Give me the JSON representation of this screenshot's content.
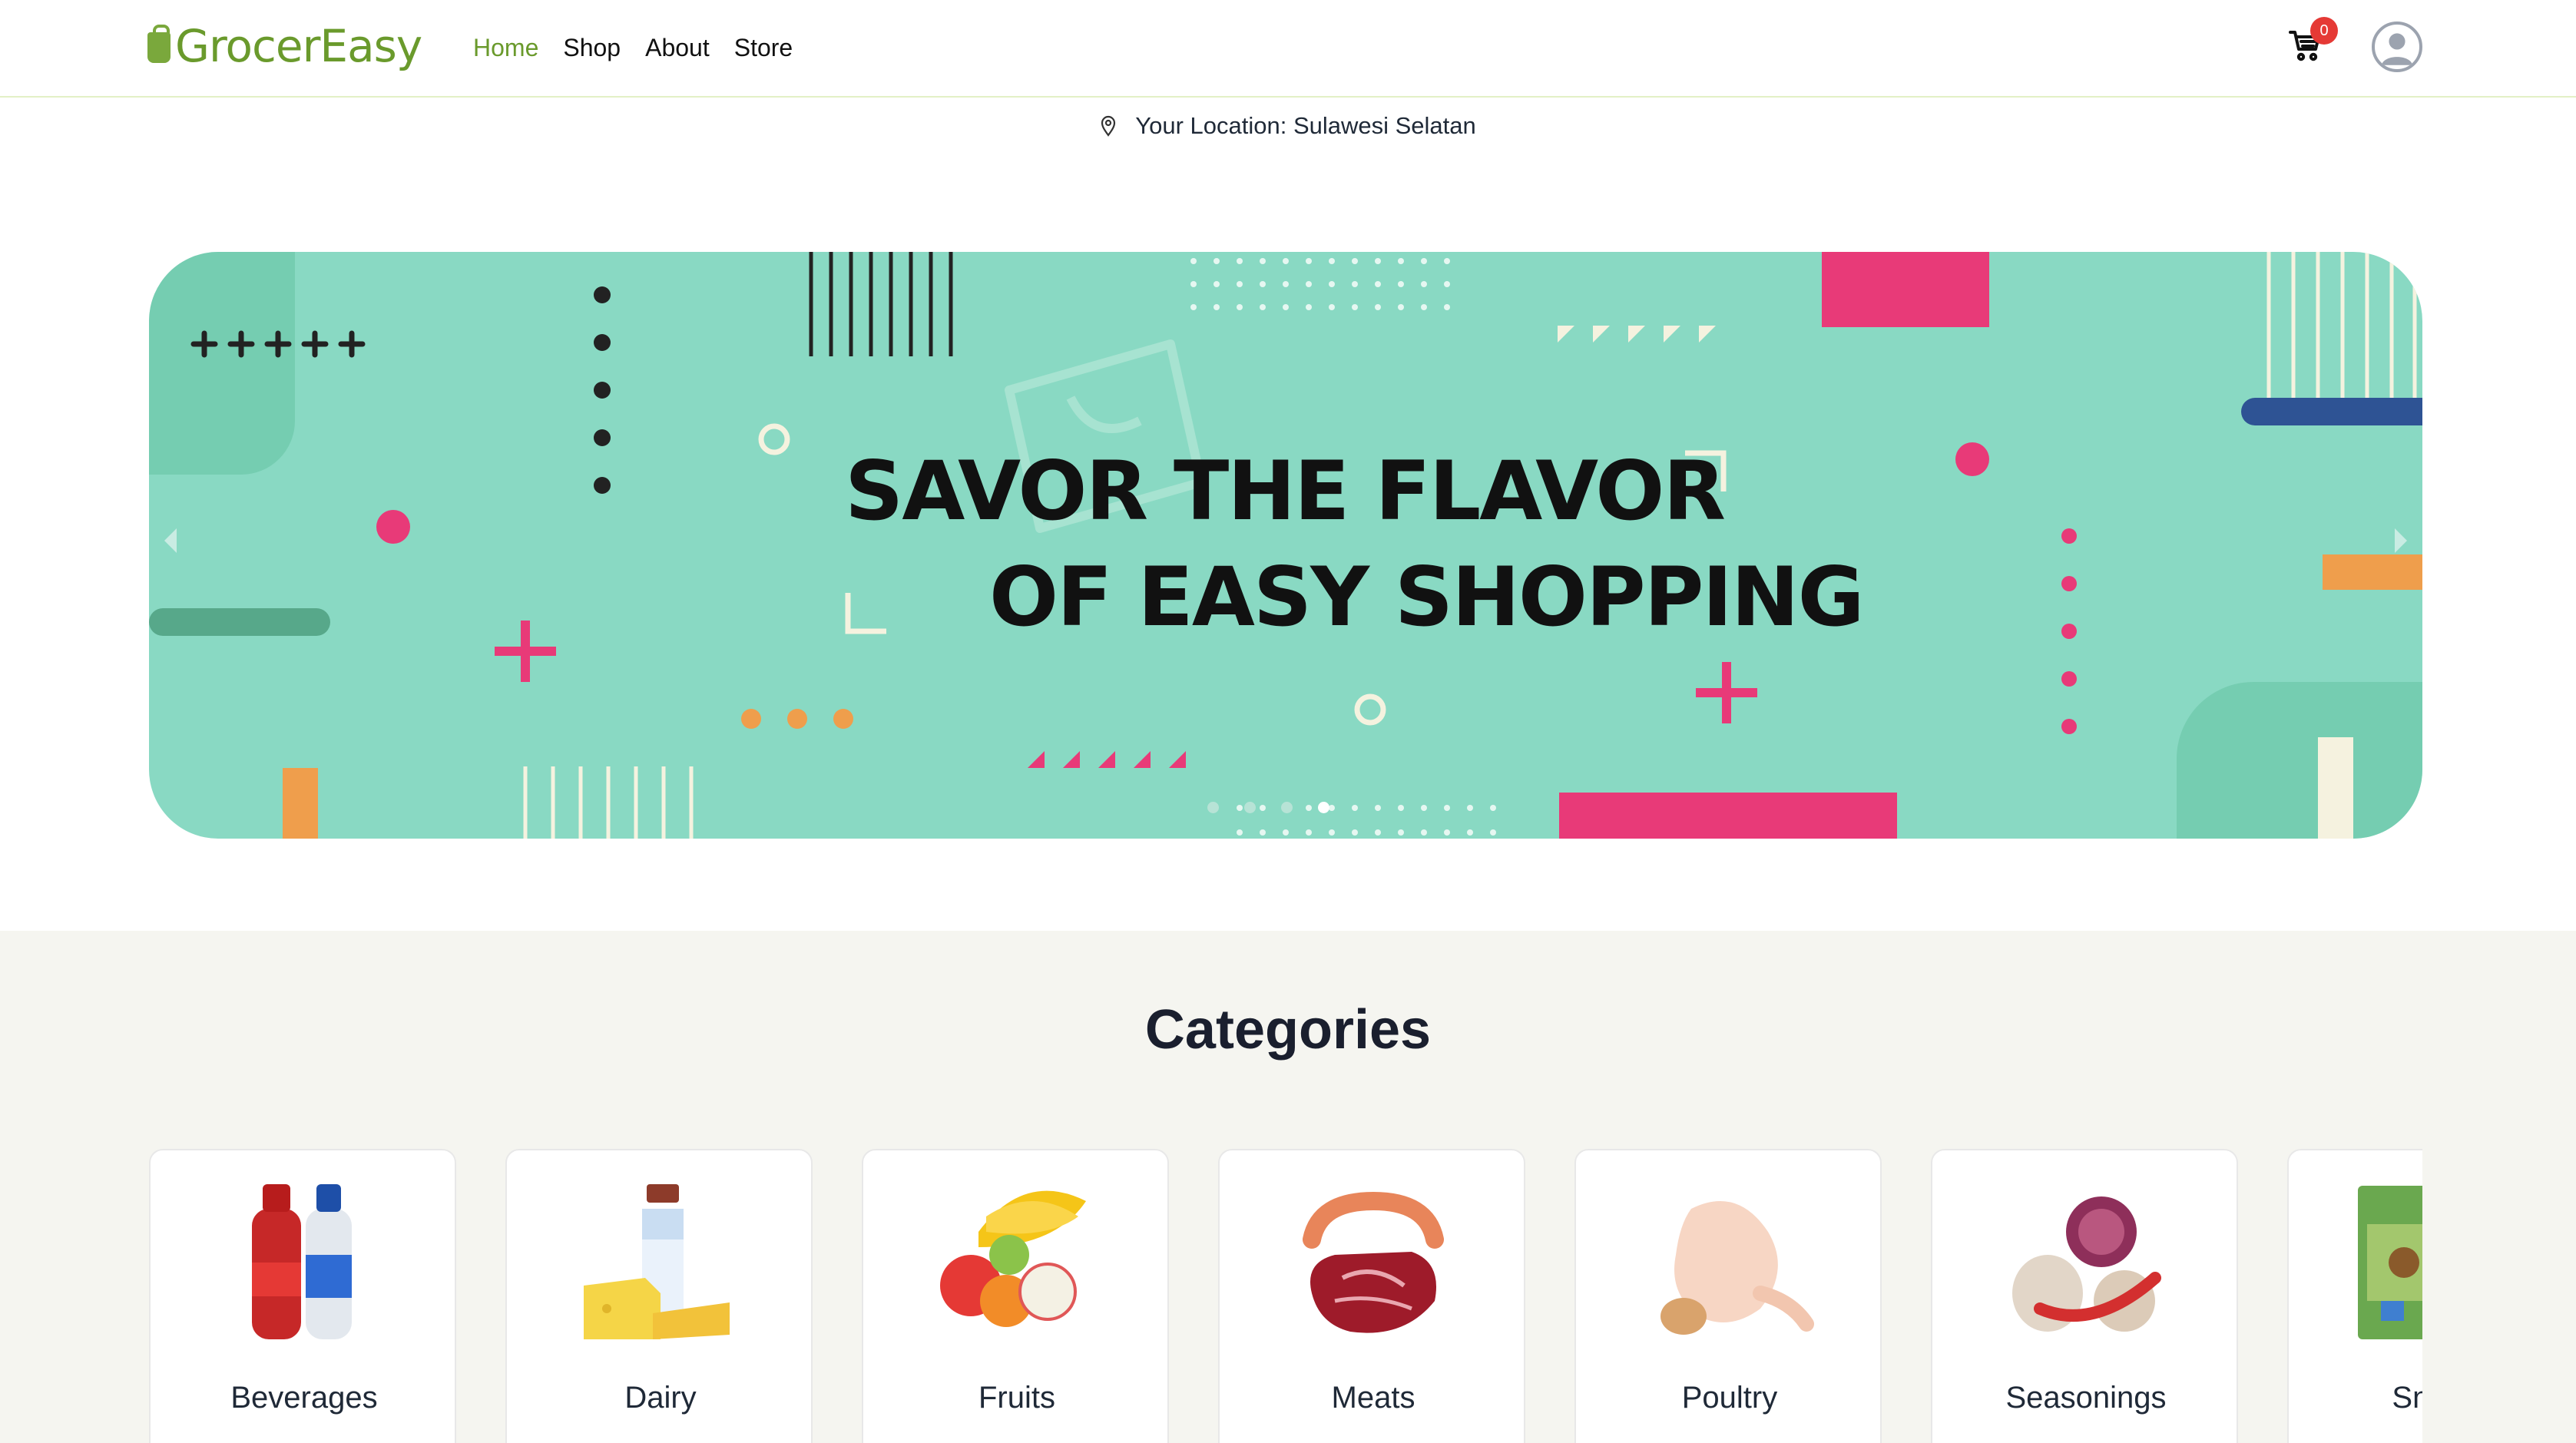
{
  "header": {
    "brand": "GrocerEasy",
    "nav": [
      "Home",
      "Shop",
      "About",
      "Store"
    ],
    "active_nav": "Home",
    "cart_count": "0"
  },
  "location": {
    "text": "Your Location: Sulawesi Selatan"
  },
  "banner": {
    "line1": "SAVOR THE FLAVOR",
    "line2": "OF EASY SHOPPING",
    "slide_count": 4,
    "active_slide": 4
  },
  "categories": {
    "heading": "Categories",
    "items": [
      "Beverages",
      "Dairy",
      "Fruits",
      "Meats",
      "Poultry",
      "Seasonings",
      "Snacks"
    ]
  },
  "colors": {
    "brand_green": "#6a9a2c",
    "banner_bg": "#89d9c3",
    "accent_pink": "#e83a78",
    "accent_orange": "#ef9e4c",
    "accent_navy": "#2e5394",
    "badge_red": "#e53935"
  }
}
